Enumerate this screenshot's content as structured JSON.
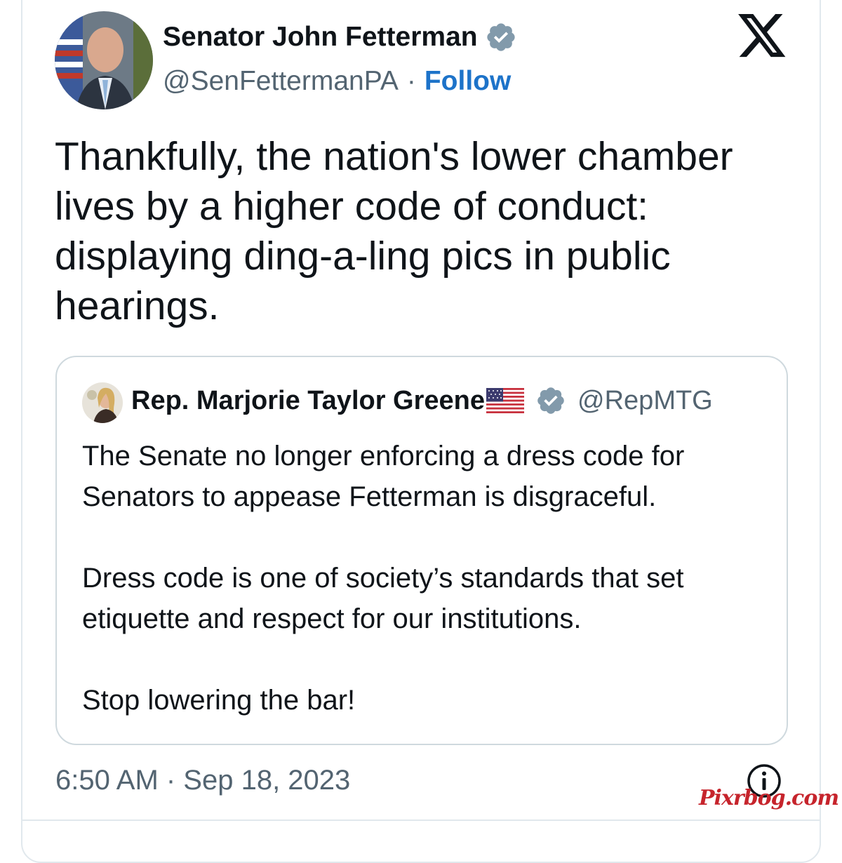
{
  "author": {
    "display_name": "Senator John Fetterman",
    "handle": "@SenFettermanPA",
    "separator": "·",
    "follow_label": "Follow",
    "verified": true
  },
  "tweet": {
    "text": "Thankfully, the nation's lower chamber lives by a higher code of conduct: displaying ding-a-ling pics in public hearings.",
    "timestamp": "6:50 AM · Sep 18, 2023"
  },
  "quoted_tweet": {
    "display_name": "Rep. Marjorie Taylor Greene",
    "handle": "@RepMTG",
    "verified": true,
    "paragraphs": [
      "The Senate no longer enforcing a dress code for Senators to appease Fetterman is disgraceful.",
      "Dress code is one of society’s standards that set etiquette and respect for our institutions.",
      "Stop lowering the bar!"
    ]
  },
  "watermark": "Pixrbog.com",
  "icons": {
    "platform_logo": "x-logo-icon",
    "verified": "verified-badge-icon",
    "flag": "us-flag-icon",
    "info": "info-icon"
  },
  "colors": {
    "link_blue": "#1d73c9",
    "verified_gray": "#829aab",
    "secondary_text": "#536471",
    "border": "#cfd9de",
    "watermark_red": "#c6242c"
  }
}
